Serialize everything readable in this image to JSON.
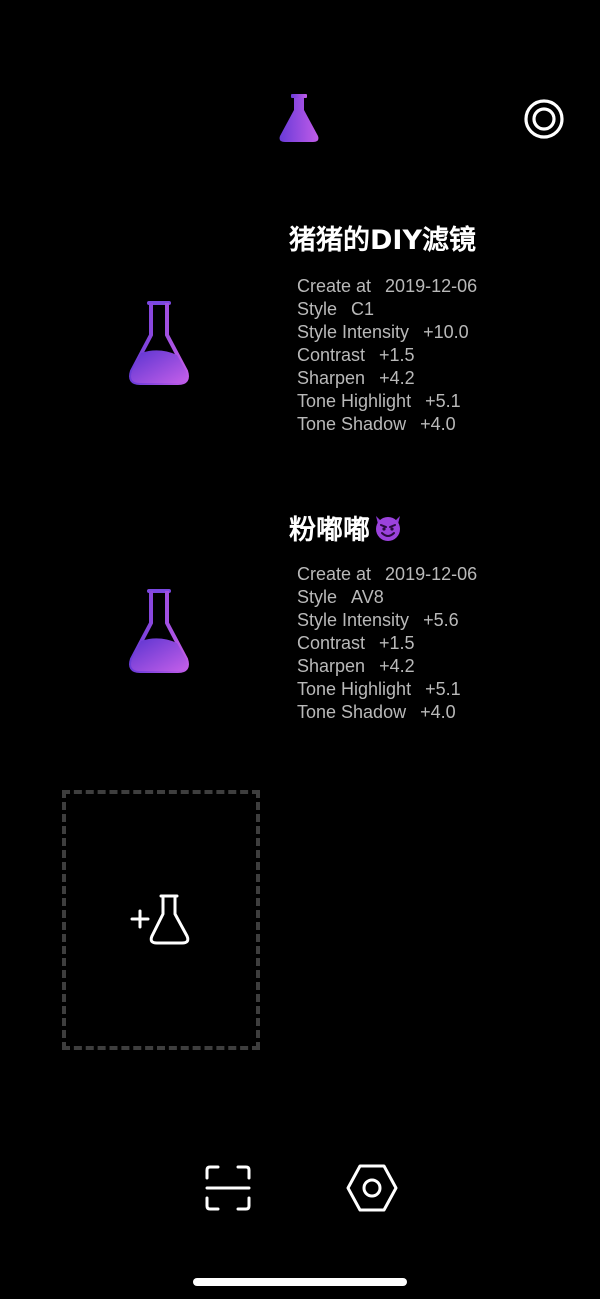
{
  "colors": {
    "background": "#000000",
    "flask_gradient_start": "#6a3bd8",
    "flask_gradient_end": "#c05ce8",
    "detail_text": "#b9b9b9",
    "dashed_border": "#3e3e3e"
  },
  "header": {
    "logo_icon": "flask-icon",
    "action_icon": "target-icon"
  },
  "filters": [
    {
      "title": "猪猪的DIY滤镜",
      "icon": "flask-icon",
      "details": [
        {
          "label": "Create at",
          "value": "2019-12-06"
        },
        {
          "label": "Style",
          "value": "C1"
        },
        {
          "label": "Style Intensity",
          "value": "+10.0"
        },
        {
          "label": "Contrast",
          "value": "+1.5"
        },
        {
          "label": "Sharpen",
          "value": "+4.2"
        },
        {
          "label": "Tone Highlight",
          "value": "+5.1"
        },
        {
          "label": "Tone Shadow",
          "value": "+4.0"
        }
      ]
    },
    {
      "title": "粉嘟嘟",
      "title_emoji": "smiling-devil-emoji",
      "icon": "flask-icon",
      "details": [
        {
          "label": "Create at",
          "value": "2019-12-06"
        },
        {
          "label": "Style",
          "value": "AV8"
        },
        {
          "label": "Style Intensity",
          "value": "+5.6"
        },
        {
          "label": "Contrast",
          "value": "+1.5"
        },
        {
          "label": "Sharpen",
          "value": "+4.2"
        },
        {
          "label": "Tone Highlight",
          "value": "+5.1"
        },
        {
          "label": "Tone Shadow",
          "value": "+4.0"
        }
      ]
    }
  ],
  "add_filter": {
    "icon": "add-flask-icon"
  },
  "bottom_bar": {
    "left_icon": "scan-icon",
    "right_icon": "settings-hexagon-icon"
  }
}
